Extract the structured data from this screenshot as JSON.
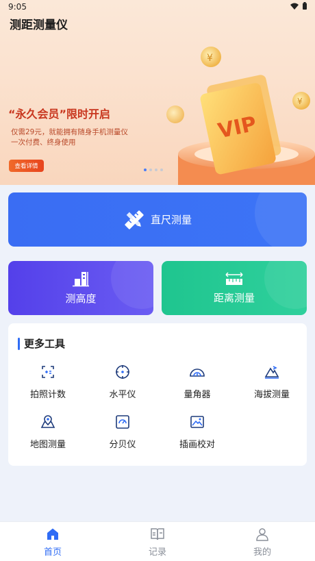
{
  "status_bar": {
    "time": "9:05"
  },
  "app": {
    "title": "测距测量仪"
  },
  "banner": {
    "promo_title": "“永久会员”限时开启",
    "promo_line1": "仅需29元，就能拥有随身手机测量仪",
    "promo_line2": "一次付费、终身使用",
    "detail_button": "查看详情",
    "vip_text": "VIP",
    "carousel": {
      "count": 4,
      "active_index": 0
    }
  },
  "main_cards": {
    "ruler": {
      "label": "直尺测量",
      "icon": "ruler-pencil-icon"
    },
    "height": {
      "label": "测高度",
      "icon": "building-height-icon"
    },
    "distance": {
      "label": "距离测量",
      "icon": "distance-tape-icon"
    }
  },
  "more_tools": {
    "title": "更多工具",
    "items": [
      {
        "label": "拍照计数",
        "icon": "photo-count-icon"
      },
      {
        "label": "水平仪",
        "icon": "level-crosshair-icon"
      },
      {
        "label": "量角器",
        "icon": "protractor-icon"
      },
      {
        "label": "海拔测量",
        "icon": "mountain-altitude-icon"
      },
      {
        "label": "地图测量",
        "icon": "map-pin-icon"
      },
      {
        "label": "分贝仪",
        "icon": "decibel-meter-icon"
      },
      {
        "label": "插画校对",
        "icon": "image-calibrate-icon"
      }
    ]
  },
  "tabbar": {
    "items": [
      {
        "label": "首页",
        "icon": "home-icon",
        "active": true
      },
      {
        "label": "记录",
        "icon": "record-book-icon",
        "active": false
      },
      {
        "label": "我的",
        "icon": "user-icon",
        "active": false
      }
    ]
  },
  "colors": {
    "primary": "#2f6cf5",
    "purple": "#5a48ee",
    "green": "#25c995",
    "promo_red": "#c8361e",
    "page_bg": "#eef2fa"
  }
}
